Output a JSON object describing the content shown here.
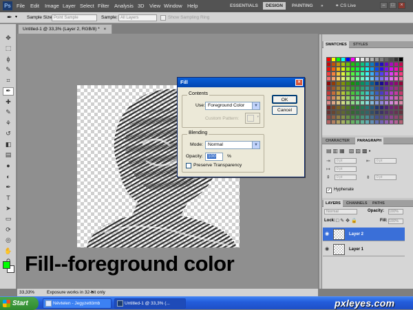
{
  "app": {
    "logo": "Ps"
  },
  "menu": [
    "File",
    "Edit",
    "Image",
    "Layer",
    "Select",
    "Filter",
    "Analysis",
    "3D",
    "View",
    "Window",
    "Help"
  ],
  "workspaces": {
    "essentials": "ESSENTIALS",
    "design": "DESIGN",
    "painting": "PAINTING",
    "more": "»"
  },
  "cslive": "CS Live",
  "window_controls": {
    "min": "–",
    "max": "□",
    "close": "×"
  },
  "options_bar": {
    "sample_size_label": "Sample Size:",
    "sample_size_value": "Point Sample",
    "sample_label": "Sample:",
    "sample_value": "All Layers",
    "show_ring_label": "Show Sampling Ring"
  },
  "document": {
    "tab_title": "Untitled-1 @ 33,3% (Layer 2, RGB/8) *",
    "tab_close": "×"
  },
  "caption": "Fill--foreground color",
  "status": {
    "zoom": "33,33%",
    "message": "Exposure works in 32-bit only"
  },
  "dialog": {
    "title": "Fill",
    "contents_label": "Contents",
    "use_label": "Use:",
    "use_value": "Foreground Color",
    "custom_pattern_label": "Custom Pattern:",
    "blending_label": "Blending",
    "mode_label": "Mode:",
    "mode_value": "Normal",
    "opacity_label": "Opacity:",
    "opacity_value": "100",
    "opacity_unit": "%",
    "preserve_label": "Preserve Transparency",
    "ok": "OK",
    "cancel": "Cancel"
  },
  "swatches_panel": {
    "tabs": [
      "SWATCHES",
      "STYLES"
    ]
  },
  "character_panel": {
    "tabs": [
      "CHARACTER",
      "PARAGRAPH"
    ],
    "values": [
      "0 pt",
      "0 pt",
      "0 pt",
      "0 pt",
      "0 pt"
    ],
    "hyphenate": "Hyphenate"
  },
  "layers_panel": {
    "tabs": [
      "LAYERS",
      "CHANNELS",
      "PATHS"
    ],
    "blend_mode": "Normal",
    "opacity_label": "Opacity:",
    "opacity_value": "100%",
    "lock_label": "Lock:",
    "fill_label": "Fill:",
    "fill_value": "100%",
    "layers": [
      {
        "name": "Layer 2",
        "selected": true
      },
      {
        "name": "Layer 1",
        "selected": false
      }
    ]
  },
  "taskbar": {
    "start": "Start",
    "tasks": [
      "Névtelen - Jegyzettömb",
      "Untitled-1 @ 33,3% (..."
    ],
    "watermark": "pxleyes.com"
  },
  "colors": {
    "foreground": "#00ff00",
    "background": "#ffffff",
    "accent": "#0a5fd8"
  },
  "icons": {
    "tools": [
      "move-icon",
      "marquee-icon",
      "lasso-icon",
      "quick-select-icon",
      "crop-icon",
      "eyedropper-icon",
      "healing-icon",
      "brush-icon",
      "stamp-icon",
      "history-brush-icon",
      "eraser-icon",
      "gradient-icon",
      "blur-icon",
      "dodge-icon",
      "pen-icon",
      "type-icon",
      "path-select-icon",
      "shape-icon",
      "3d-rotate-icon",
      "3d-orbit-icon",
      "hand-icon",
      "zoom-icon"
    ],
    "tool_glyphs": [
      "✥",
      "⬚",
      "ϕ",
      "✎",
      "⌗",
      "✒",
      "✚",
      "✎",
      "⚘",
      "↺",
      "◧",
      "▤",
      "●",
      "◐",
      "✒",
      "T",
      "➤",
      "▭",
      "⟳",
      "◎",
      "✋",
      "⚲"
    ],
    "dock": [
      "swatch-icon",
      "adjust-icon",
      "mask-icon",
      "sun-icon",
      "brush-icon",
      "layer-icon",
      "character-icon",
      "paragraph-icon",
      "tool-preset-icon",
      "clone-icon"
    ],
    "dock_glyphs": [
      "▦",
      "◑",
      "▣",
      "✺",
      "✎",
      "▤",
      "A",
      "¶",
      "⚙",
      "⚲"
    ]
  }
}
